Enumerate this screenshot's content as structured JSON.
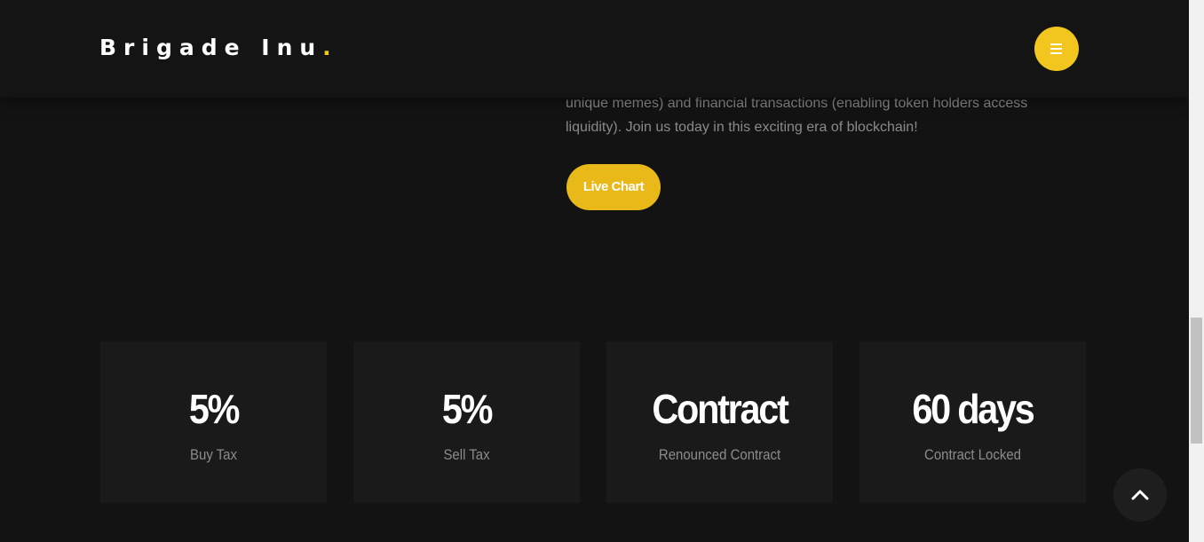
{
  "header": {
    "logo_text": "Brigade Inu",
    "logo_dot": ".",
    "menu_icon": "hamburger-menu-icon"
  },
  "about": {
    "lines": [
      "unique memes) and financial transactions (enabling token holders access",
      "liquidity). Join us today in this exciting era of blockchain!"
    ],
    "button_label": "Live Chart"
  },
  "stats": [
    {
      "value": "5%",
      "label": "Buy Tax"
    },
    {
      "value": "5%",
      "label": "Sell Tax"
    },
    {
      "value": "Contract",
      "label": "Renounced Contract"
    },
    {
      "value": "60 days",
      "label": "Contract Locked"
    }
  ],
  "scroll_top": {
    "icon": "chevron-up-icon"
  },
  "colors": {
    "background": "#131313",
    "accent": "#f2c61f",
    "card": "#1a1a1a",
    "text_muted": "#8c8c8c"
  }
}
